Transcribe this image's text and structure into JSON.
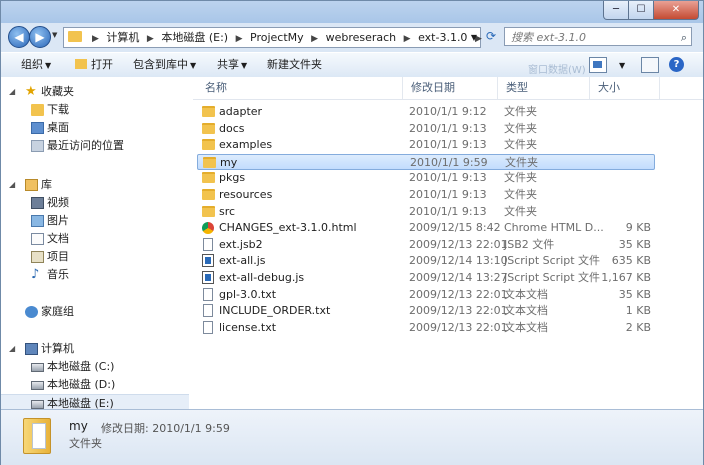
{
  "window": {
    "controls": {
      "minimize": "─",
      "maximize": "☐",
      "close": "✕"
    }
  },
  "address": {
    "crumbs": [
      "计算机",
      "本地磁盘 (E:)",
      "ProjectMy",
      "webreserach",
      "ext-3.1.0"
    ],
    "search_placeholder": "搜索 ext-3.1.0"
  },
  "toolbar": {
    "organize": "组织",
    "open": "打开",
    "include_in_library": "包含到库中",
    "share": "共享",
    "new_folder": "新建文件夹",
    "faded_text": "窗口数据(W)"
  },
  "nav": {
    "favorites_label": "收藏夹",
    "favorites": [
      "下载",
      "桌面",
      "最近访问的位置"
    ],
    "libraries_label": "库",
    "libraries": [
      "视频",
      "图片",
      "文档",
      "项目",
      "音乐"
    ],
    "homegroup_label": "家庭组",
    "computer_label": "计算机",
    "drives": [
      "本地磁盘 (C:)",
      "本地磁盘 (D:)",
      "本地磁盘 (E:)"
    ],
    "selected_drive": "本地磁盘 (E:)"
  },
  "columns": {
    "name": "名称",
    "date": "修改日期",
    "type": "类型",
    "size": "大小"
  },
  "files": [
    {
      "name": "adapter",
      "date": "2010/1/1 9:12",
      "type": "文件夹",
      "size": "",
      "icon": "folder"
    },
    {
      "name": "docs",
      "date": "2010/1/1 9:13",
      "type": "文件夹",
      "size": "",
      "icon": "folder"
    },
    {
      "name": "examples",
      "date": "2010/1/1 9:13",
      "type": "文件夹",
      "size": "",
      "icon": "folder"
    },
    {
      "name": "my",
      "date": "2010/1/1 9:59",
      "type": "文件夹",
      "size": "",
      "icon": "folder"
    },
    {
      "name": "pkgs",
      "date": "2010/1/1 9:13",
      "type": "文件夹",
      "size": "",
      "icon": "folder"
    },
    {
      "name": "resources",
      "date": "2010/1/1 9:13",
      "type": "文件夹",
      "size": "",
      "icon": "folder"
    },
    {
      "name": "src",
      "date": "2010/1/1 9:13",
      "type": "文件夹",
      "size": "",
      "icon": "folder"
    },
    {
      "name": "CHANGES_ext-3.1.0.html",
      "date": "2009/12/15 8:42",
      "type": "Chrome HTML D...",
      "size": "9 KB",
      "icon": "chrome"
    },
    {
      "name": "ext.jsb2",
      "date": "2009/12/13 22:01",
      "type": "JSB2 文件",
      "size": "35 KB",
      "icon": "file"
    },
    {
      "name": "ext-all.js",
      "date": "2009/12/14 13:10",
      "type": "JScript Script 文件",
      "size": "635 KB",
      "icon": "js"
    },
    {
      "name": "ext-all-debug.js",
      "date": "2009/12/14 13:27",
      "type": "JScript Script 文件",
      "size": "1,167 KB",
      "icon": "js"
    },
    {
      "name": "gpl-3.0.txt",
      "date": "2009/12/13 22:01",
      "type": "文本文档",
      "size": "35 KB",
      "icon": "file"
    },
    {
      "name": "INCLUDE_ORDER.txt",
      "date": "2009/12/13 22:01",
      "type": "文本文档",
      "size": "1 KB",
      "icon": "file"
    },
    {
      "name": "license.txt",
      "date": "2009/12/13 22:01",
      "type": "文本文档",
      "size": "2 KB",
      "icon": "file"
    }
  ],
  "selected_file": "my",
  "details": {
    "name": "my",
    "modified_label": "修改日期:",
    "modified_value": "2010/1/1 9:59",
    "type": "文件夹"
  }
}
